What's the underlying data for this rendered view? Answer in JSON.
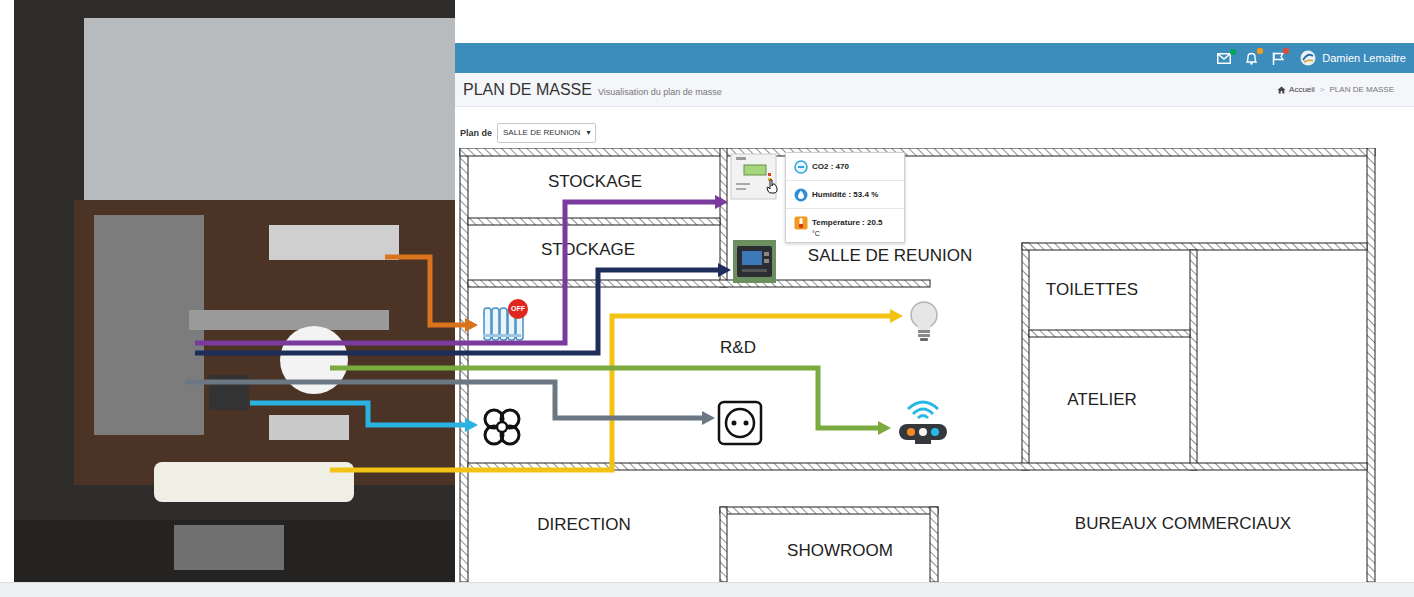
{
  "header": {
    "user": "Damien Lemaitre",
    "notifications": [
      {
        "kind": "mail",
        "color": "#00a65a"
      },
      {
        "kind": "bell",
        "color": "#f39c12"
      },
      {
        "kind": "flag",
        "color": "#dd4b39"
      }
    ]
  },
  "page": {
    "title": "PLAN DE MASSE",
    "subtitle": "Visualisation du plan de masse",
    "separator": ">",
    "breadcrumb": [
      {
        "label": "Accueil",
        "selected": false
      },
      {
        "label": "PLAN DE MASSE",
        "selected": true
      }
    ]
  },
  "plan_selector": {
    "label": "Plan de",
    "value": "SALLE DE REUNION",
    "arrow": "▾"
  },
  "rooms": [
    {
      "name": "STOCKAGE"
    },
    {
      "name": "STOCKAGE"
    },
    {
      "name": "SALLE DE REUNION"
    },
    {
      "name": "TOILETTES"
    },
    {
      "name": "ATELIER"
    },
    {
      "name": "R&D"
    },
    {
      "name": "DIRECTION"
    },
    {
      "name": "SHOWROOM"
    },
    {
      "name": "BUREAUX COMMERCIAUX"
    }
  ],
  "devices": [
    {
      "kind": "sensor",
      "color": "#7b3a9e"
    },
    {
      "kind": "controller",
      "color": "#1f2d5a"
    },
    {
      "kind": "radiator",
      "color": "#d9731c",
      "badge": "OFF",
      "on": false
    },
    {
      "kind": "bulb",
      "color": "#f2c314"
    },
    {
      "kind": "fan",
      "color": "#2ab3e0"
    },
    {
      "kind": "outlet",
      "color": "#6b7884"
    },
    {
      "kind": "hub",
      "color": "#7aab3e"
    }
  ],
  "tooltip": {
    "rows": [
      {
        "kind": "co2",
        "label": "CO2",
        "value": ": 470",
        "unit": ""
      },
      {
        "kind": "humidity",
        "label": "Humidité",
        "value": ": 53.4 %",
        "unit": ""
      },
      {
        "kind": "temperature",
        "label": "Température",
        "value": ": 20.5",
        "unit": "°C"
      }
    ]
  }
}
